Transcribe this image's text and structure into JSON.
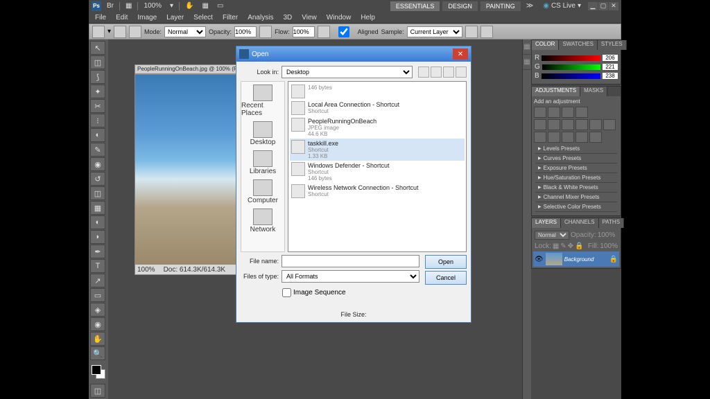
{
  "titlebar": {
    "ps": "Ps",
    "zoom": "100%",
    "tabs": [
      "ESSENTIALS",
      "DESIGN",
      "PAINTING"
    ],
    "cslive": "CS Live"
  },
  "menu": [
    "File",
    "Edit",
    "Image",
    "Layer",
    "Select",
    "Filter",
    "Analysis",
    "3D",
    "View",
    "Window",
    "Help"
  ],
  "optbar": {
    "mode_label": "Mode:",
    "mode": "Normal",
    "opacity_label": "Opacity:",
    "opacity": "100%",
    "flow_label": "Flow:",
    "flow": "100%",
    "aligned_label": "Aligned",
    "sample_label": "Sample:",
    "sample": "Current Layer"
  },
  "doc": {
    "tab": "PeopleRunningOnBeach.jpg @ 100% (R...",
    "zoom": "100%",
    "status": "Doc: 614.3K/614.3K"
  },
  "color": {
    "tabs": [
      "COLOR",
      "SWATCHES",
      "STYLES"
    ],
    "r": "206",
    "g": "221",
    "b": "238"
  },
  "adjustments": {
    "tabs": [
      "ADJUSTMENTS",
      "MASKS"
    ],
    "title": "Add an adjustment"
  },
  "presets": [
    "Levels Presets",
    "Curves Presets",
    "Exposure Presets",
    "Hue/Saturation Presets",
    "Black & White Presets",
    "Channel Mixer Presets",
    "Selective Color Presets"
  ],
  "layers": {
    "tabs": [
      "LAYERS",
      "CHANNELS",
      "PATHS"
    ],
    "mode": "Normal",
    "opacity_label": "Opacity:",
    "opacity": "100%",
    "lock_label": "Lock:",
    "fill_label": "Fill:",
    "fill": "100%",
    "name": "Background"
  },
  "dialog": {
    "title": "Open",
    "lookin_label": "Look in:",
    "lookin": "Desktop",
    "places": [
      "Recent Places",
      "Desktop",
      "Libraries",
      "Computer",
      "Network"
    ],
    "files": [
      {
        "name": "",
        "meta": "146 bytes"
      },
      {
        "name": "Local Area Connection - Shortcut",
        "meta": "Shortcut"
      },
      {
        "name": "PeopleRunningOnBeach",
        "meta": "JPEG image",
        "meta2": "44.6 KB"
      },
      {
        "name": "taskkill.exe",
        "meta": "Shortcut",
        "meta2": "1.33 KB",
        "sel": true
      },
      {
        "name": "Windows Defender - Shortcut",
        "meta": "Shortcut",
        "meta2": "146 bytes"
      },
      {
        "name": "Wireless Network Connection - Shortcut",
        "meta": "Shortcut"
      }
    ],
    "filename_label": "File name:",
    "filename": "",
    "filetype_label": "Files of type:",
    "filetype": "All Formats",
    "open_btn": "Open",
    "cancel_btn": "Cancel",
    "imageseq": "Image Sequence",
    "filesize": "File Size:"
  }
}
